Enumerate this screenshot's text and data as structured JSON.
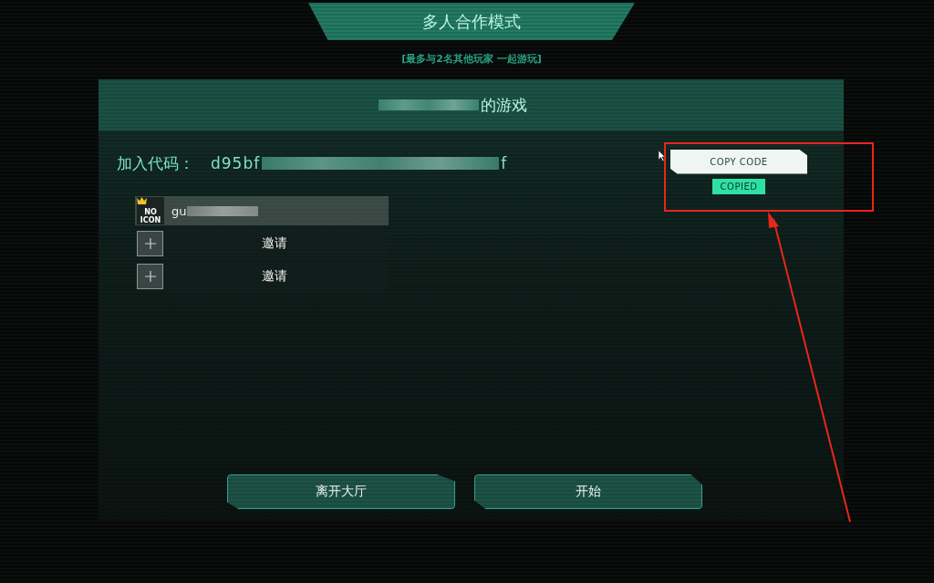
{
  "header": {
    "title": "多人合作模式",
    "subtitle": "[最多与2名其他玩家 一起游玩]"
  },
  "lobby": {
    "title": "的游戏",
    "code_label": "加入代码：",
    "code_start": "d95bf",
    "code_end": "f"
  },
  "copy": {
    "button": "COPY CODE",
    "status": "COPIED"
  },
  "players": [
    {
      "kind": "host",
      "name": "gu",
      "avatar_top": "NO",
      "avatar_bottom": "ICON"
    },
    {
      "kind": "empty",
      "label": "邀请"
    },
    {
      "kind": "empty",
      "label": "邀请"
    }
  ],
  "buttons": [
    "离开大厅",
    "开始"
  ]
}
